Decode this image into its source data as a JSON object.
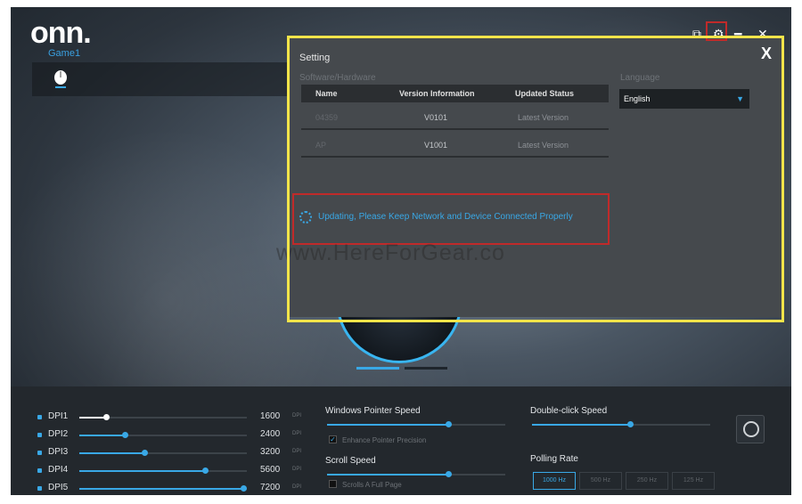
{
  "app": {
    "logo": "onn.",
    "profile": "Game1",
    "window_controls": [
      "⧉",
      "⚙",
      "━",
      "✕"
    ]
  },
  "setting_dialog": {
    "title": "Setting",
    "close": "X",
    "section_label": "Software/Hardware",
    "language_label": "Language",
    "language_value": "English",
    "table": {
      "headers": [
        "Name",
        "Version Information",
        "Updated Status"
      ],
      "rows": [
        {
          "name": "04359",
          "version": "V0101",
          "status": "Latest Version"
        },
        {
          "name": "AP",
          "version": "V1001",
          "status": "Latest Version"
        }
      ]
    },
    "update_message": "Updating, Please Keep Network and Device  Connected Properly"
  },
  "watermark": "www.HereForGear.co",
  "bottom": {
    "dpi": [
      {
        "label": "DPI1",
        "value": "1600",
        "unit": "DPI",
        "level": 0.16,
        "active": true
      },
      {
        "label": "DPI2",
        "value": "2400",
        "unit": "DPI",
        "level": 0.27,
        "active": false
      },
      {
        "label": "DPI3",
        "value": "3200",
        "unit": "DPI",
        "level": 0.39,
        "active": false
      },
      {
        "label": "DPI4",
        "value": "5600",
        "unit": "DPI",
        "level": 0.75,
        "active": false
      },
      {
        "label": "DPI5",
        "value": "7200",
        "unit": "DPI",
        "level": 0.98,
        "active": false
      }
    ],
    "pointer_speed": {
      "title": "Windows Pointer Speed",
      "level": 0.68,
      "checkbox_label": "Enhance Pointer Precision",
      "checked": true
    },
    "scroll_speed": {
      "title": "Scroll Speed",
      "level": 0.68,
      "checkbox_label": "Scrolls A Full Page",
      "checked": false
    },
    "double_click": {
      "title": "Double-click Speed",
      "level": 0.55
    },
    "polling_rate": {
      "title": "Polling Rate",
      "options": [
        "1000 Hz",
        "500 Hz",
        "250 Hz",
        "125 Hz"
      ],
      "selected": "1000 Hz"
    }
  },
  "colors": {
    "accent": "#39a8e6",
    "highlight_yellow": "#f2e44a",
    "highlight_red": "#c02a2a"
  }
}
